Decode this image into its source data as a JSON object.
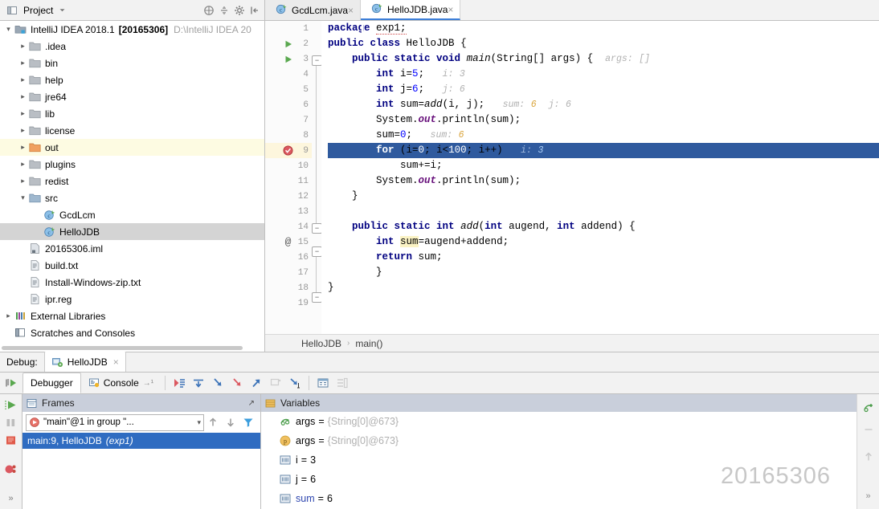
{
  "project_panel": {
    "title": "Project",
    "icons": [
      "project-view-icon",
      "chevron-down-icon",
      "collapse-all-icon",
      "expand-icon",
      "settings-gear-icon",
      "hide-panel-icon"
    ],
    "root": {
      "label": "IntelliJ IDEA 2018.1",
      "badge": "[20165306]",
      "path": "D:\\IntelliJ IDEA 20"
    },
    "items": [
      {
        "label": ".idea",
        "icon": "folder-icon",
        "indent": 1,
        "arrow": "collapsed",
        "state": "normal"
      },
      {
        "label": "bin",
        "icon": "folder-icon",
        "indent": 1,
        "arrow": "collapsed",
        "state": "normal"
      },
      {
        "label": "help",
        "icon": "folder-icon",
        "indent": 1,
        "arrow": "collapsed",
        "state": "normal"
      },
      {
        "label": "jre64",
        "icon": "folder-icon",
        "indent": 1,
        "arrow": "collapsed",
        "state": "normal"
      },
      {
        "label": "lib",
        "icon": "folder-icon",
        "indent": 1,
        "arrow": "collapsed",
        "state": "normal"
      },
      {
        "label": "license",
        "icon": "folder-icon",
        "indent": 1,
        "arrow": "collapsed",
        "state": "normal"
      },
      {
        "label": "out",
        "icon": "folder-orange-icon",
        "indent": 1,
        "arrow": "collapsed",
        "state": "highlight"
      },
      {
        "label": "plugins",
        "icon": "folder-icon",
        "indent": 1,
        "arrow": "collapsed",
        "state": "normal"
      },
      {
        "label": "redist",
        "icon": "folder-icon",
        "indent": 1,
        "arrow": "collapsed",
        "state": "normal"
      },
      {
        "label": "src",
        "icon": "folder-blue-icon",
        "indent": 1,
        "arrow": "expanded",
        "state": "normal"
      },
      {
        "label": "GcdLcm",
        "icon": "java-class-icon",
        "indent": 2,
        "arrow": "none",
        "state": "normal"
      },
      {
        "label": "HelloJDB",
        "icon": "java-class-icon",
        "indent": 2,
        "arrow": "none",
        "state": "selected"
      },
      {
        "label": "20165306.iml",
        "icon": "iml-file-icon",
        "indent": 1,
        "arrow": "none",
        "state": "normal"
      },
      {
        "label": "build.txt",
        "icon": "text-file-icon",
        "indent": 1,
        "arrow": "none",
        "state": "normal"
      },
      {
        "label": "Install-Windows-zip.txt",
        "icon": "text-file-icon",
        "indent": 1,
        "arrow": "none",
        "state": "normal"
      },
      {
        "label": "ipr.reg",
        "icon": "text-file-icon",
        "indent": 1,
        "arrow": "none",
        "state": "normal"
      },
      {
        "label": "External Libraries",
        "icon": "libraries-icon",
        "indent": 0,
        "arrow": "collapsed",
        "state": "normal"
      },
      {
        "label": "Scratches and Consoles",
        "icon": "scratches-icon",
        "indent": 0,
        "arrow": "none",
        "state": "normal"
      }
    ]
  },
  "editor_tabs": [
    {
      "label": "GcdLcm.java",
      "icon": "java-class-icon",
      "close": "×",
      "active": false
    },
    {
      "label": "HelloJDB.java",
      "icon": "java-class-icon",
      "close": "×",
      "active": true
    }
  ],
  "editor": {
    "line_numbers": [
      "1",
      "2",
      "3",
      "4",
      "5",
      "6",
      "7",
      "8",
      "9",
      "10",
      "11",
      "12",
      "13",
      "14",
      "15",
      "16",
      "17",
      "18",
      "19"
    ],
    "gutter_marks": [
      {
        "line": 2,
        "icon": "run-class-icon"
      },
      {
        "line": 3,
        "icon": "run-method-icon"
      },
      {
        "line": 9,
        "icon": "breakpoint-icon"
      },
      {
        "line": 14,
        "icon": "override-annotation-icon"
      }
    ],
    "highlight_line": 9,
    "code": {
      "l1": {
        "kw": "package",
        "rest": "exp1;"
      },
      "l2": {
        "kw": "public class",
        "name": "HelloJDB",
        "rest": "{"
      },
      "l3": {
        "text": "public static void main(String[] args) {",
        "hint_name": "args:",
        "hint_val": "[]"
      },
      "l4": {
        "text": "int i=5;",
        "hint_name": "i:",
        "hint_val": "3"
      },
      "l5": {
        "text": "int j=6;",
        "hint_name": "j:",
        "hint_val": "6"
      },
      "l6": {
        "text": "int sum=add(i, j);",
        "hint_name": "sum:",
        "hint_val": "6",
        "hint_name2": "j:",
        "hint_val2": "6"
      },
      "l7": {
        "text": "System.out.println(sum);"
      },
      "l8": {
        "text": "sum=0;",
        "hint_name": "sum:",
        "hint_val": "6"
      },
      "l9": {
        "text": "for (i=0; i<100; i++)",
        "hint_name": "i:",
        "hint_val": "3"
      },
      "l10": {
        "text": "sum+=i;"
      },
      "l11": {
        "text": "System.out.println(sum);"
      },
      "l12": {
        "text": "}"
      },
      "l13": {
        "text": ""
      },
      "l14": {
        "text": "public static int add(int augend, int addend) {"
      },
      "l15": {
        "text": "int sum=augend+addend;"
      },
      "l16": {
        "text": "return sum;"
      },
      "l17": {
        "text": "}"
      },
      "l18": {
        "text": "}"
      },
      "l19": {
        "text": ""
      }
    },
    "breadcrumb": {
      "class": "HelloJDB",
      "sep": "›",
      "method": "main()"
    }
  },
  "debug": {
    "label": "Debug:",
    "session_tab": {
      "label": "HelloJDB",
      "icon": "debug-config-icon",
      "close": "×"
    },
    "restart_icon": "rerun-debug-icon",
    "tabs": [
      {
        "label": "Debugger",
        "icon": "debugger-icon",
        "active": true
      },
      {
        "label": "Console",
        "icon": "console-icon",
        "active": false,
        "suffix": "→¹"
      }
    ],
    "step_buttons": [
      {
        "name": "show-execution-point-button",
        "icon": "execution-point-icon",
        "enabled": true
      },
      {
        "name": "step-over-button",
        "icon": "step-over-icon",
        "enabled": true
      },
      {
        "name": "step-into-button",
        "icon": "step-into-icon",
        "enabled": true
      },
      {
        "name": "force-step-into-button",
        "icon": "force-step-into-icon",
        "enabled": true
      },
      {
        "name": "step-out-button",
        "icon": "step-out-icon",
        "enabled": true
      },
      {
        "name": "drop-frame-button",
        "icon": "drop-frame-icon",
        "enabled": false
      },
      {
        "name": "run-to-cursor-button",
        "icon": "run-to-cursor-icon",
        "enabled": true
      },
      {
        "name": "evaluate-expression-button",
        "icon": "evaluate-icon",
        "enabled": true
      },
      {
        "name": "layout-settings-button",
        "icon": "layout-icon",
        "enabled": false
      }
    ],
    "left_actions": [
      {
        "name": "resume-program-button",
        "icon": "resume-icon"
      },
      {
        "name": "pause-program-button",
        "icon": "pause-icon"
      },
      {
        "name": "stop-program-button",
        "icon": "stop-icon"
      },
      {
        "name": "view-breakpoints-button",
        "icon": "breakpoints-icon"
      },
      {
        "name": "more-actions-button",
        "icon": "more-chevrons-icon"
      }
    ],
    "frames": {
      "title": "Frames",
      "settings_icon": "settings-arrow-icon",
      "thread": "\"main\"@1 in group \"...",
      "thread_icon": "thread-running-icon",
      "dropdown_icon": "chevron-down-icon",
      "controls": [
        "arrow-up-icon",
        "arrow-down-icon",
        "filter-icon"
      ],
      "stack": [
        {
          "label": "main:9, HelloJDB",
          "module": "(exp1)",
          "selected": true
        }
      ]
    },
    "variables": {
      "title": "Variables",
      "title_icon": "variables-icon",
      "rows": [
        {
          "icon": "watch-icon",
          "name": "args",
          "eq": "=",
          "value": "{String[0]@673}",
          "value_style": "gray",
          "name_style": "normal"
        },
        {
          "icon": "parameter-icon",
          "name": "args",
          "eq": "=",
          "value": "{String[0]@673}",
          "value_style": "gray",
          "name_style": "normal"
        },
        {
          "icon": "primitive-icon",
          "name": "i",
          "eq": "=",
          "value": "3",
          "value_style": "normal",
          "name_style": "normal"
        },
        {
          "icon": "primitive-icon",
          "name": "j",
          "eq": "=",
          "value": "6",
          "value_style": "normal",
          "name_style": "normal"
        },
        {
          "icon": "primitive-icon",
          "name": "sum",
          "eq": "=",
          "value": "6",
          "value_style": "normal",
          "name_style": "blue"
        }
      ],
      "side_actions": [
        {
          "name": "add-watch-button",
          "icon": "add-watch-icon"
        },
        {
          "name": "remove-watch-button",
          "icon": "minus-icon"
        },
        {
          "name": "move-up-button",
          "icon": "arrow-up-icon"
        },
        {
          "name": "more-actions-button",
          "icon": "more-chevrons-icon"
        }
      ]
    }
  },
  "watermark": "20165306",
  "colors": {
    "selection_blue": "#2f5a9e",
    "frame_selected": "#2f6cc1",
    "panel_header": "#c9cfdb",
    "toolbar_bg": "#f2f2f2",
    "highlight_yellow": "#fdfbe2",
    "keyword": "#000080",
    "number": "#0000ff",
    "static_field": "#660e7a",
    "hint_gray": "#b0b0b0",
    "hint_orange": "#d9a43b"
  }
}
